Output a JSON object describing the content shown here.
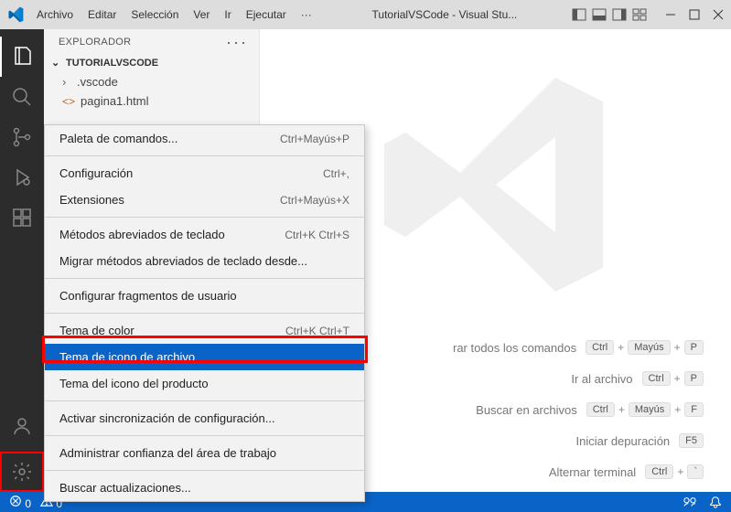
{
  "titlebar": {
    "menus": [
      "Archivo",
      "Editar",
      "Selección",
      "Ver",
      "Ir",
      "Ejecutar"
    ],
    "overflow": "···",
    "title": "TutorialVSCode - Visual Stu..."
  },
  "explorer": {
    "header": "EXPLORADOR",
    "project": "TUTORIALVSCODE",
    "items": [
      {
        "label": ".vscode",
        "icon": "folder",
        "expandable": true
      },
      {
        "label": "pagina1.html",
        "icon": "html",
        "expandable": false
      }
    ]
  },
  "context_menu": [
    {
      "type": "item",
      "label": "Paleta de comandos...",
      "shortcut": "Ctrl+Mayús+P"
    },
    {
      "type": "sep"
    },
    {
      "type": "item",
      "label": "Configuración",
      "shortcut": "Ctrl+,"
    },
    {
      "type": "item",
      "label": "Extensiones",
      "shortcut": "Ctrl+Mayús+X"
    },
    {
      "type": "sep"
    },
    {
      "type": "item",
      "label": "Métodos abreviados de teclado",
      "shortcut": "Ctrl+K Ctrl+S"
    },
    {
      "type": "item",
      "label": "Migrar métodos abreviados de teclado desde..."
    },
    {
      "type": "sep"
    },
    {
      "type": "item",
      "label": "Configurar fragmentos de usuario"
    },
    {
      "type": "sep"
    },
    {
      "type": "item",
      "label": "Tema de color",
      "shortcut": "Ctrl+K Ctrl+T"
    },
    {
      "type": "item",
      "label": "Tema de icono de archivo",
      "selected": true
    },
    {
      "type": "item",
      "label": "Tema del icono del producto"
    },
    {
      "type": "sep"
    },
    {
      "type": "item",
      "label": "Activar sincronización de configuración..."
    },
    {
      "type": "sep"
    },
    {
      "type": "item",
      "label": "Administrar confianza del área de trabajo"
    },
    {
      "type": "sep"
    },
    {
      "type": "item",
      "label": "Buscar actualizaciones..."
    }
  ],
  "welcome_commands": [
    {
      "label": "rar todos los comandos",
      "keys": [
        "Ctrl",
        "Mayús",
        "P"
      ]
    },
    {
      "label": "Ir al archivo",
      "keys": [
        "Ctrl",
        "P"
      ]
    },
    {
      "label": "Buscar en archivos",
      "keys": [
        "Ctrl",
        "Mayús",
        "F"
      ]
    },
    {
      "label": "Iniciar depuración",
      "keys": [
        "F5"
      ]
    },
    {
      "label": "Alternar terminal",
      "keys": [
        "Ctrl",
        "`"
      ]
    }
  ],
  "statusbar": {
    "errors": "0",
    "warnings": "0"
  }
}
